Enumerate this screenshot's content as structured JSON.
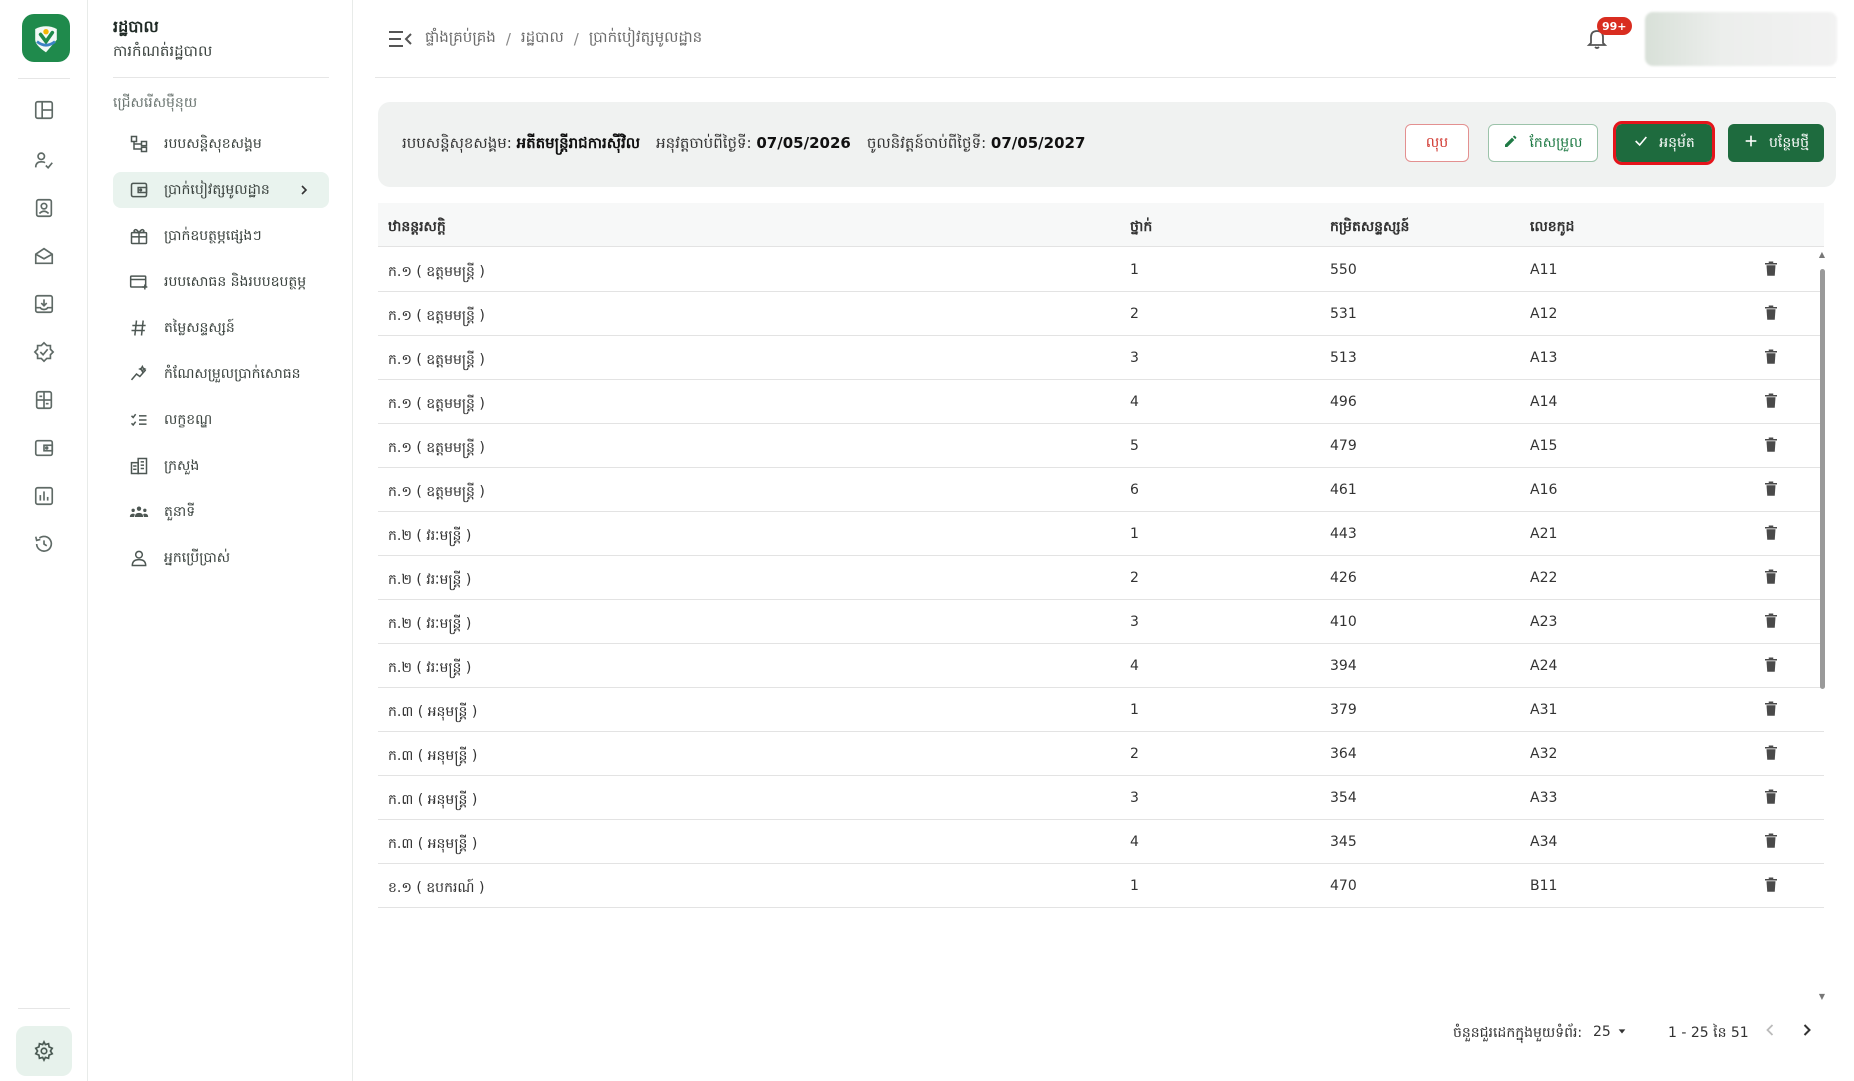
{
  "sidebar": {
    "title": "រដ្ឋបាល",
    "subtitle": "ការកំណត់រដ្ឋបាល",
    "section_label": "ជ្រើសរើសម៉ឺនុយ",
    "items": [
      {
        "label": "របបសន្តិសុខសង្គម",
        "icon": "hierarchy-icon"
      },
      {
        "label": "ប្រាក់បៀវត្សមូលដ្ឋាន",
        "icon": "wallet-icon",
        "active": true
      },
      {
        "label": "ប្រាក់ឧបត្ថម្ភផ្សេងៗ",
        "icon": "gift-icon"
      },
      {
        "label": "របបសោធន និងរបបឧបត្ថម្ភ",
        "icon": "card-add-icon"
      },
      {
        "label": "តម្លៃសន្ទស្សន៍",
        "icon": "hash-icon"
      },
      {
        "label": "កំណែសម្រួលប្រាក់សោធន",
        "icon": "trend-icon"
      },
      {
        "label": "លក្ខខណ្ឌ",
        "icon": "checklist-icon"
      },
      {
        "label": "ក្រសួង",
        "icon": "building-icon"
      },
      {
        "label": "តួនាទី",
        "icon": "group-icon"
      },
      {
        "label": "អ្នកប្រើប្រាស់",
        "icon": "user-icon"
      }
    ]
  },
  "rail": {
    "icons": [
      "dashboard-icon",
      "user-check-icon",
      "id-card-icon",
      "mail-open-icon",
      "inbox-download-icon",
      "verified-icon",
      "calculator-icon",
      "wallet-icon",
      "report-chart-icon",
      "history-icon"
    ],
    "settings_icon": "settings-icon"
  },
  "topbar": {
    "breadcrumbs": [
      "ផ្ទាំងគ្រប់គ្រង",
      "រដ្ឋបាល",
      "ប្រាក់បៀវត្សមូលដ្ឋាន"
    ],
    "notification_badge": "99+"
  },
  "infobar": {
    "regime_label": "របបសន្តិសុខសង្គម:",
    "regime_value": "អតីតមន្ត្រីរាជការស៊ីវិល",
    "effective_label": "អនុវត្តចាប់ពីថ្ងៃទី:",
    "effective_value": "07/05/2026",
    "expire_label": "ចូលនិវត្តន៍ចាប់ពីថ្ងៃទី:",
    "expire_value": "07/05/2027",
    "delete_label": "លុប",
    "edit_label": "កែសម្រួល",
    "approve_label": "អនុម័ត",
    "add_label": "បន្ថែមថ្មី"
  },
  "table": {
    "headers": [
      "ឋានន្តរសក្តិ",
      "ថ្នាក់",
      "កម្រិតសន្ទស្សន៍",
      "លេខកូដ"
    ],
    "rows": [
      [
        "ក.១ ( ឧត្តមមន្ត្រី )",
        "1",
        "550",
        "A11"
      ],
      [
        "ក.១ ( ឧត្តមមន្ត្រី )",
        "2",
        "531",
        "A12"
      ],
      [
        "ក.១ ( ឧត្តមមន្ត្រី )",
        "3",
        "513",
        "A13"
      ],
      [
        "ក.១ ( ឧត្តមមន្ត្រី )",
        "4",
        "496",
        "A14"
      ],
      [
        "ក.១ ( ឧត្តមមន្ត្រី )",
        "5",
        "479",
        "A15"
      ],
      [
        "ក.១ ( ឧត្តមមន្ត្រី )",
        "6",
        "461",
        "A16"
      ],
      [
        "ក.២ ( វរៈមន្ត្រី )",
        "1",
        "443",
        "A21"
      ],
      [
        "ក.២ ( វរៈមន្ត្រី )",
        "2",
        "426",
        "A22"
      ],
      [
        "ក.២ ( វរៈមន្ត្រី )",
        "3",
        "410",
        "A23"
      ],
      [
        "ក.២ ( វរៈមន្ត្រី )",
        "4",
        "394",
        "A24"
      ],
      [
        "ក.៣ ( អនុមន្ត្រី )",
        "1",
        "379",
        "A31"
      ],
      [
        "ក.៣ ( អនុមន្ត្រី )",
        "2",
        "364",
        "A32"
      ],
      [
        "ក.៣ ( អនុមន្ត្រី )",
        "3",
        "354",
        "A33"
      ],
      [
        "ក.៣ ( អនុមន្ត្រី )",
        "4",
        "345",
        "A34"
      ],
      [
        "ខ.១ ( ឧបករណ៍ )",
        "1",
        "470",
        "B11"
      ]
    ]
  },
  "pagination": {
    "rows_per_page_label": "ចំនួនជួរដេកក្នុងមួយទំព័រ:",
    "rows_per_page": "25",
    "range": "1 - 25 នៃ 51"
  },
  "colors": {
    "primary": "#1e6b3e",
    "danger": "#d0342c",
    "highlight": "#e5141b",
    "badge": "#d92d20"
  }
}
